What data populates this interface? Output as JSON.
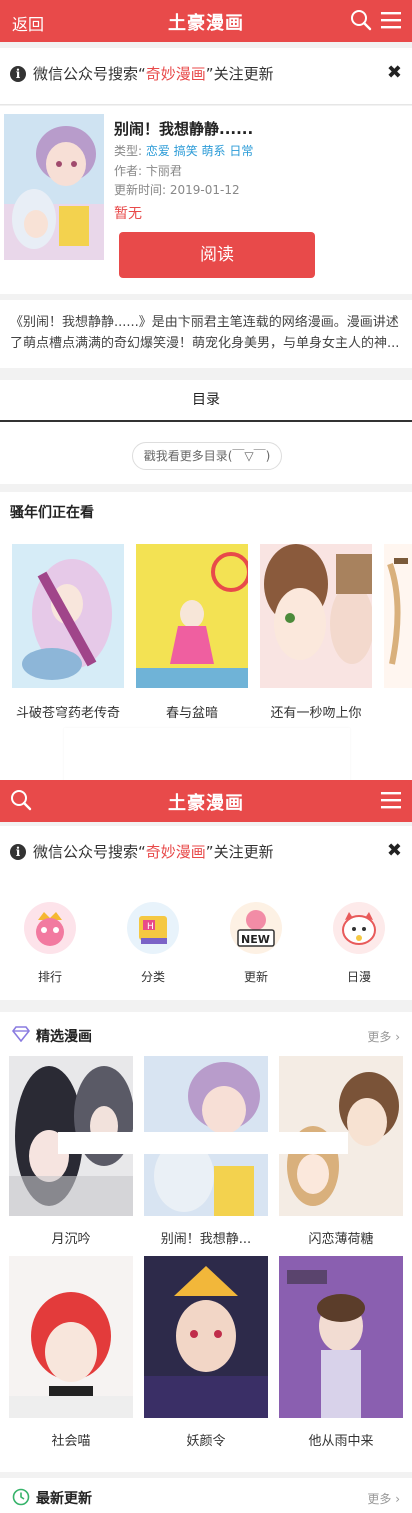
{
  "top_header": {
    "back_label": "返回",
    "logo": "土豪漫画"
  },
  "notice": {
    "prefix": "微信公众号搜索“",
    "highlight": "奇妙漫画",
    "suffix": "”关注更新",
    "close": "✖"
  },
  "comic": {
    "title": "别闹！我想静静......",
    "type_label": "类型:",
    "tags": "恋爱 搞笑 萌系 日常",
    "author_label": "作者:",
    "author": "卞丽君",
    "updated_label": "更新时间:",
    "updated": "2019-01-12",
    "status": "暂无",
    "read_button": "阅读"
  },
  "description": "《别闹！我想静静......》是由卞丽君主笔连载的网络漫画。漫画讲述了萌点槽点满满的奇幻爆笑漫！萌宠化身美男，与单身女主人的神...",
  "toc": {
    "tab_label": "目录",
    "more_button": "戳我看更多目录(￣▽￣)"
  },
  "watching": {
    "title": "骚年们正在看",
    "items": [
      {
        "label": "斗破苍穹药老传奇"
      },
      {
        "label": "春与盆暗"
      },
      {
        "label": "还有一秒吻上你"
      },
      {
        "label": ""
      }
    ]
  },
  "second_header": {
    "logo": "土豪漫画"
  },
  "notice2": {
    "prefix": "微信公众号搜索“",
    "highlight": "奇妙漫画",
    "suffix": "”关注更新",
    "close": "✖"
  },
  "categories": [
    {
      "label": "排行",
      "icon": "ranking-icon"
    },
    {
      "label": "分类",
      "icon": "category-icon"
    },
    {
      "label": "更新",
      "icon": "new-icon"
    },
    {
      "label": "日漫",
      "icon": "japan-comic-icon"
    }
  ],
  "featured": {
    "title": "精选漫画",
    "more": "更多",
    "items": [
      {
        "label": "月沉吟"
      },
      {
        "label": "别闹！我想静..."
      },
      {
        "label": "闪恋薄荷糖"
      },
      {
        "label": "社会喵"
      },
      {
        "label": "妖颜令"
      },
      {
        "label": "他从雨中来"
      }
    ]
  },
  "latest": {
    "title": "最新更新",
    "more": "更多"
  },
  "colors": {
    "brand_red": "#e84a4a",
    "tag_blue": "#2b9bd7"
  }
}
